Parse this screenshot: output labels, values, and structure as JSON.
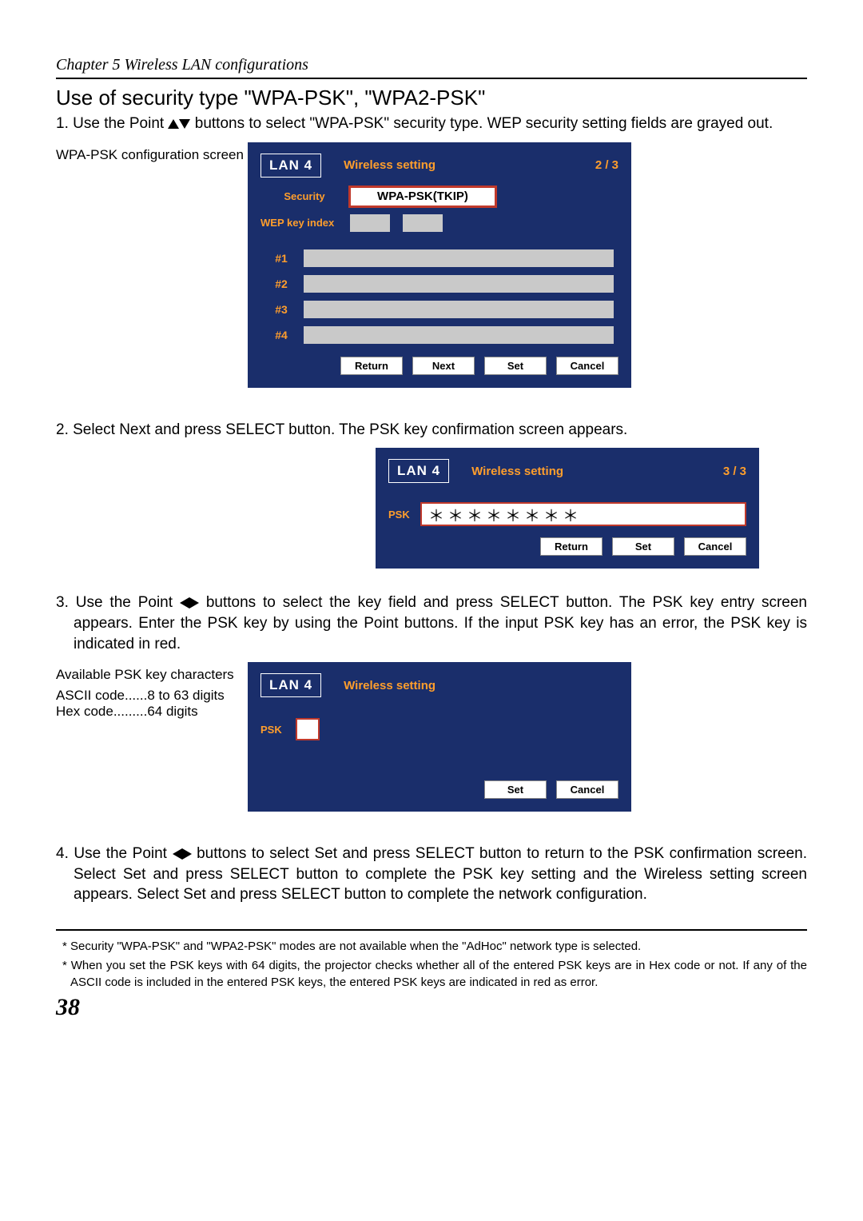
{
  "chapter": "Chapter 5 Wireless LAN configurations",
  "section_title": "Use of security type \"WPA-PSK\", \"WPA2-PSK\"",
  "step1_pre": "1. Use the Point ",
  "step1_post": " buttons to select \"WPA-PSK\" security type. WEP security setting fields are grayed out.",
  "caption1": "WPA-PSK configuration screen",
  "step2": "2. Select  Next  and press SELECT button. The PSK key confirmation screen appears.",
  "step3_pre": "3. Use the Point ",
  "step3_post": " buttons to select the key field and press SELECT button. The PSK key entry screen appears. Enter the PSK key by using the Point buttons. If the input PSK key has an error, the PSK key is indicated in red.",
  "avail_title": "Available PSK key characters",
  "avail_ascii": "ASCII code......8 to 63 digits",
  "avail_hex": "Hex code.........64 digits",
  "step4_pre": "4. Use the Point ",
  "step4_post": " buttons to select  Set  and press SELECT button to return to the PSK confirmation screen. Select  Set   and press SELECT button to complete the PSK key setting and the Wireless setting screen appears. Select  Set   and press SELECT button to complete the network configuration.",
  "footnote1": "* Security \"WPA-PSK\" and \"WPA2-PSK\" modes are not available when the \"AdHoc\" network type is selected.",
  "footnote2": "* When you set the PSK keys with 64 digits, the projector checks whether all of the entered PSK keys are in Hex code or not. If any of the ASCII code is included in the entered PSK keys, the entered PSK keys are indicated in red as error.",
  "page_number": "38",
  "osd1": {
    "lan": "LAN 4",
    "title": "Wireless setting",
    "page": "2 / 3",
    "security_label": "Security",
    "security_value": "WPA-PSK(TKIP)",
    "wep_label": "WEP key index",
    "k1": "#1",
    "k2": "#2",
    "k3": "#3",
    "k4": "#4",
    "btn_return": "Return",
    "btn_next": "Next",
    "btn_set": "Set",
    "btn_cancel": "Cancel"
  },
  "osd2": {
    "lan": "LAN 4",
    "title": "Wireless setting",
    "page": "3 / 3",
    "psk_label": "PSK",
    "psk_value": "＊＊＊＊＊＊＊＊",
    "btn_return": "Return",
    "btn_set": "Set",
    "btn_cancel": "Cancel"
  },
  "osd3": {
    "lan": "LAN 4",
    "title": "Wireless setting",
    "psk_label": "PSK",
    "btn_set": "Set",
    "btn_cancel": "Cancel"
  }
}
